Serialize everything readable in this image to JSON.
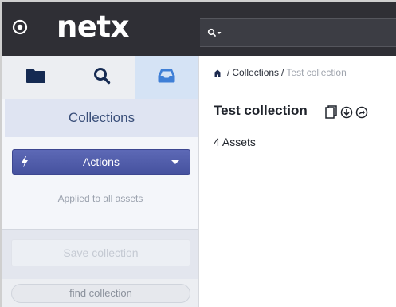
{
  "header": {
    "logo_text": "netx",
    "menu_icon": "circle-menu-icon",
    "search_icon": "search-dropdown-icon",
    "background_color": "#2f2f35"
  },
  "sidebar": {
    "tabs": [
      {
        "name": "folders",
        "icon": "folder-icon",
        "active": false
      },
      {
        "name": "search",
        "icon": "search-icon",
        "active": false
      },
      {
        "name": "collections",
        "icon": "inbox-icon",
        "active": true
      }
    ],
    "panel_title": "Collections",
    "actions_label": "Actions",
    "applied_note": "Applied to all assets",
    "save_label": "Save collection",
    "find_label": "find collection",
    "accent_color": "#4f5aa8"
  },
  "breadcrumb": {
    "home_icon": "home-icon",
    "items": [
      "Collections",
      "Test collection"
    ]
  },
  "main": {
    "title": "Test collection",
    "asset_count": "4 Assets",
    "title_icons": [
      "copy-icon",
      "download-icon",
      "share-icon"
    ]
  }
}
